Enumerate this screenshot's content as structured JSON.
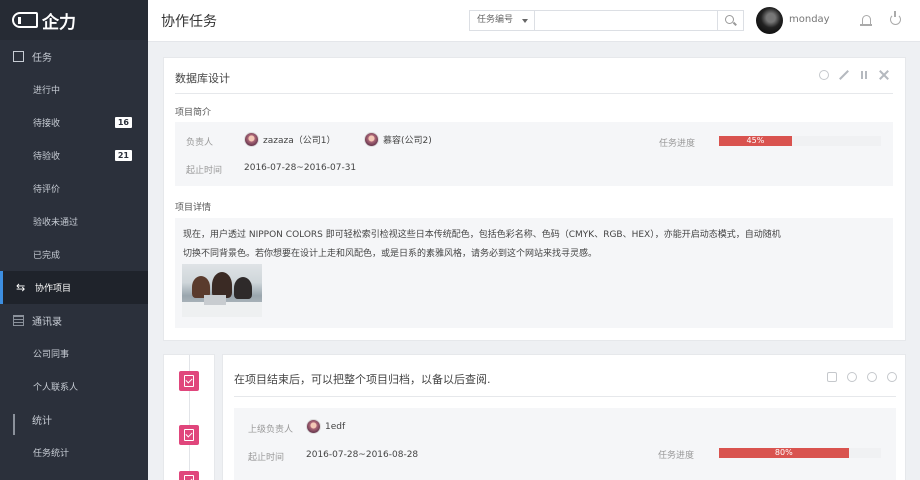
{
  "sidebar": {
    "logo": "企力",
    "groups": [
      {
        "label": "任务",
        "icon": "calendar-icon"
      },
      {
        "label": "协作项目",
        "icon": "swap-icon"
      },
      {
        "label": "通讯录",
        "icon": "list-icon"
      },
      {
        "label": "统计",
        "icon": "bar-chart-icon"
      }
    ],
    "task_items": [
      {
        "label": "进行中"
      },
      {
        "label": "待接收",
        "badge": "16"
      },
      {
        "label": "待验收",
        "badge": "21"
      },
      {
        "label": "待评价"
      },
      {
        "label": "验收未通过"
      },
      {
        "label": "已完成"
      }
    ],
    "contact_items": [
      {
        "label": "公司同事"
      },
      {
        "label": "个人联系人"
      }
    ],
    "stat_items": [
      {
        "label": "任务统计"
      }
    ]
  },
  "header": {
    "title": "协作任务",
    "search_select": "任务编号",
    "search_placeholder": "",
    "username": "monday"
  },
  "card1": {
    "title": "数据库设计",
    "section_intro": "项目简介",
    "owner_label": "负责人",
    "owners": [
      "zazaza（公司1）",
      "慕容(公司2)"
    ],
    "time_label": "起止时间",
    "time_value": "2016-07-28~2016-07-31",
    "progress_label": "任务进度",
    "progress_text": "45%",
    "progress": 45,
    "section_detail": "项目详情",
    "detail_line1": "现在，用户透过 NIPPON COLORS 即可轻松索引检视这些日本传统配色，包括色彩名称、色码（CMYK、RGB、HEX），亦能开启动态模式，自动随机",
    "detail_line2": "切换不同背景色。若你想要在设计上走和风配色，或是日系的素雅风格，请务必到这个网站来找寻灵感。"
  },
  "card2": {
    "title": "在项目结束后，可以把整个项目归档，以备以后查阅.",
    "owner_label": "上级负责人",
    "owner": "1edf",
    "time_label": "起止时间",
    "time_value": "2016-07-28~2016-08-28",
    "progress_label": "任务进度",
    "progress_text": "80%",
    "progress": 80
  },
  "colors": {
    "sidebar_bg": "#2b303b",
    "accent": "#3d8ee0",
    "progress": "#d9534f",
    "timeline_icon": "#e0467c"
  }
}
